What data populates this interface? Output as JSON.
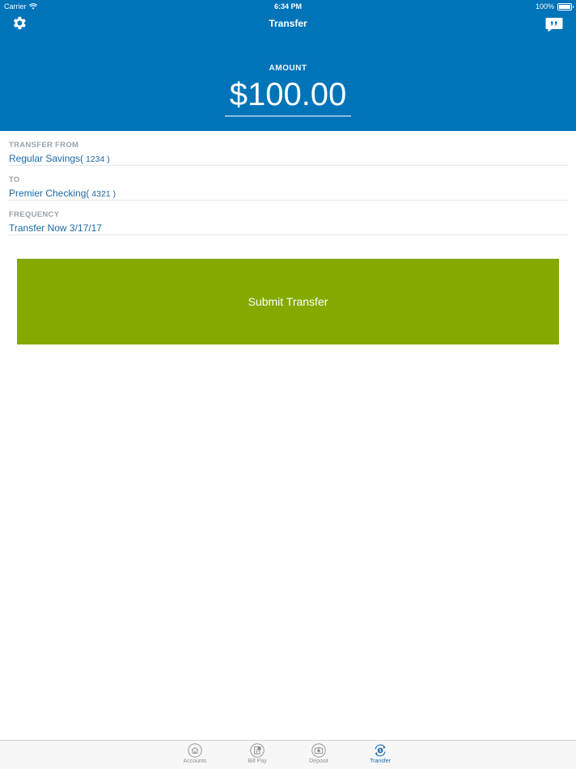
{
  "status_bar": {
    "carrier": "Carrier",
    "time": "6:34 PM",
    "battery": "100%"
  },
  "nav": {
    "title": "Transfer",
    "settings_icon": "gear-icon",
    "chat_icon": "quote-bubble-icon"
  },
  "amount": {
    "label": "AMOUNT",
    "value": "$100.00"
  },
  "transfer": {
    "from_label": "TRANSFER FROM",
    "from_name": "Regular Savings(",
    "from_number": " 1234 )",
    "to_label": "TO",
    "to_name": "Premier Checking(",
    "to_number": " 4321 )",
    "frequency_label": "FREQUENCY",
    "frequency_value": "Transfer Now  3/17/17"
  },
  "submit_label": "Submit Transfer",
  "tabs": [
    {
      "label": "Accounts",
      "icon": "house-icon",
      "active": false
    },
    {
      "label": "Bill Pay",
      "icon": "bill-icon",
      "active": false
    },
    {
      "label": "Deposit",
      "icon": "camera-icon",
      "active": false
    },
    {
      "label": "Transfer",
      "icon": "transfer-icon",
      "active": true
    }
  ],
  "colors": {
    "brand_blue": "#0074b8",
    "submit_green": "#84aa00",
    "value_blue": "#1a6aa8",
    "label_gray": "#9aa3ab"
  }
}
